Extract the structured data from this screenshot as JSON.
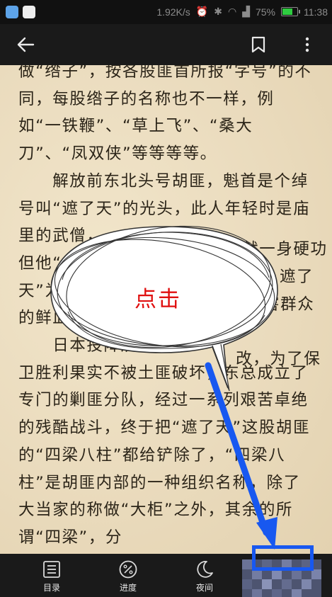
{
  "status_bar": {
    "speed": "1.92K/s",
    "battery": "75%",
    "time": "11:38",
    "battery_level": 0.75
  },
  "toolbar": {
    "back_icon": "arrow-left-icon",
    "bookmark_icon": "bookmark-icon",
    "more_icon": "more-vertical-icon"
  },
  "content": {
    "paragraphs": [
      "做“绺子”，按各股匪首所报“字号”的不同，每股绺子的名称也不一样，例如“一铁鞭”、“草上飞”、“桑大刀”、“凤双侠”等等等等。",
      "　　解放前东北头号胡匪，魁首是个绰号叫“遮了天”的光头，此人年轻时是庙里的武僧，",
      "但他“",
      "天”为",
      "的鲜血",
      "　　日本投降后东北",
      "卫胜利果实不被土匪破坏，东总成立了专门的剿匪分队，经过一系列艰苦卓绝的残酷战斗，终于把“遮了天”这股胡匪的“四梁八柱”都给铲除了，“四梁八柱”是胡匪内部的一种组织名称，除了大当家的称做“大柜”之外，其余的所谓“四梁”，分"
    ],
    "fragments": [
      "练就一身硬功夫，",
      "遮了",
      "害群众",
      "改，为了保"
    ]
  },
  "annotation": {
    "bubble_text": "点击",
    "arrow_color": "#1858f0",
    "text_color": "#e01010"
  },
  "bottom_bar": {
    "items": [
      {
        "label": "目录",
        "icon": "list-icon"
      },
      {
        "label": "进度",
        "icon": "progress-percent-icon"
      },
      {
        "label": "夜间",
        "icon": "moon-icon"
      },
      {
        "label": "",
        "icon": "settings-icon"
      }
    ]
  }
}
